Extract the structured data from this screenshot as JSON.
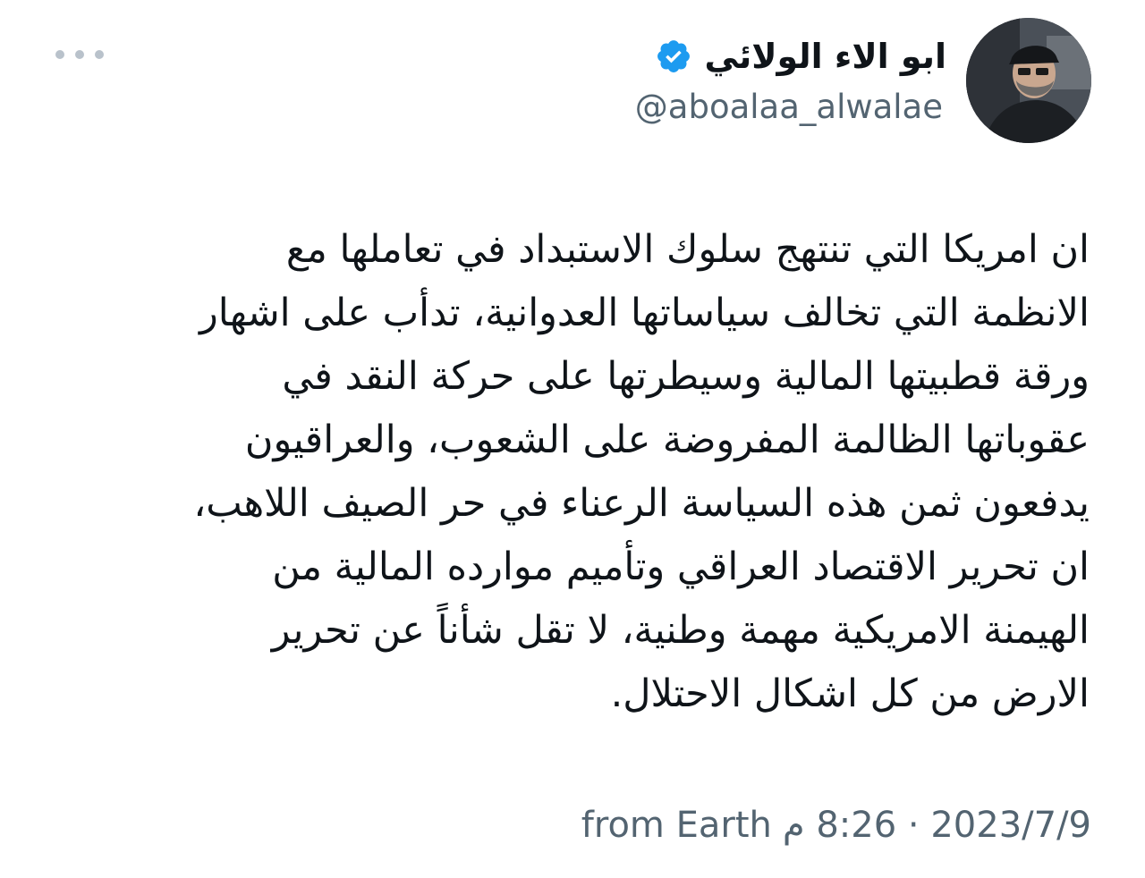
{
  "user": {
    "display_name": "ابو الاء الولائي",
    "handle": "@aboalaa_alwalae",
    "verified_icon": "verified-badge-icon",
    "verified_color": "#1d9bf0"
  },
  "more_icon": "more-dots-icon",
  "tweet": {
    "lines": [
      "ان امريكا التي تنتهج سلوك الاستبداد في تعاملها مع",
      "الانظمة التي تخالف سياساتها العدوانية، تدأب على اشهار",
      "ورقة قطبيتها المالية وسيطرتها على حركة النقد في",
      "عقوباتها الظالمة المفروضة على الشعوب، والعراقيون",
      "يدفعون ثمن هذه السياسة الرعناء في حر الصيف اللاهب،",
      "ان تحرير الاقتصاد العراقي وتأميم موارده المالية من",
      "الهيمنة الامريكية مهمة وطنية، لا تقل شأناً عن تحرير",
      "الارض من كل اشكال الاحتلال."
    ]
  },
  "meta": {
    "source": "from Earth",
    "time": "8:26 م",
    "separator": " · ",
    "date": "2023/7/9"
  }
}
